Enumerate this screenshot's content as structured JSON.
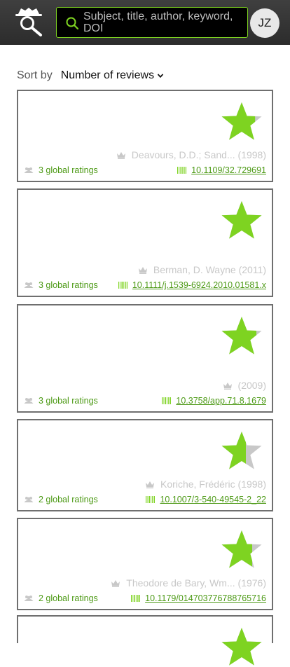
{
  "header": {
    "search_placeholder": "Subject, title, author, keyword, DOI",
    "avatar_initials": "JZ"
  },
  "sort": {
    "label": "Sort by",
    "selected": "Number of reviews"
  },
  "colors": {
    "accent": "#7ed321",
    "link": "#4d9a16",
    "star_empty": "#c8c8c8",
    "border": "#6f6f6f"
  },
  "results": [
    {
      "author": "Deavours, D.D.; Sand...",
      "year": "(1998)",
      "ratings": "3 global ratings",
      "doi": "10.1109/32.729691",
      "star_fill": 0.82
    },
    {
      "author": "Berman, D. Wayne",
      "year": "(2011)",
      "ratings": "3 global ratings",
      "doi": "10.1111/j.1539-6924.2010.01581.x",
      "star_fill": 1.0
    },
    {
      "author": "",
      "year": "(2009)",
      "ratings": "3 global ratings",
      "doi": "10.3758/app.71.8.1679",
      "star_fill": 0.85
    },
    {
      "author": "Koriche, Frédéric",
      "year": "(1998)",
      "ratings": "2 global ratings",
      "doi": "10.1007/3-540-49545-2_22",
      "star_fill": 0.6
    },
    {
      "author": "Theodore de Bary, Wm...",
      "year": "(1976)",
      "ratings": "2 global ratings",
      "doi": "10.1179/014703776788765716",
      "star_fill": 0.75
    }
  ]
}
